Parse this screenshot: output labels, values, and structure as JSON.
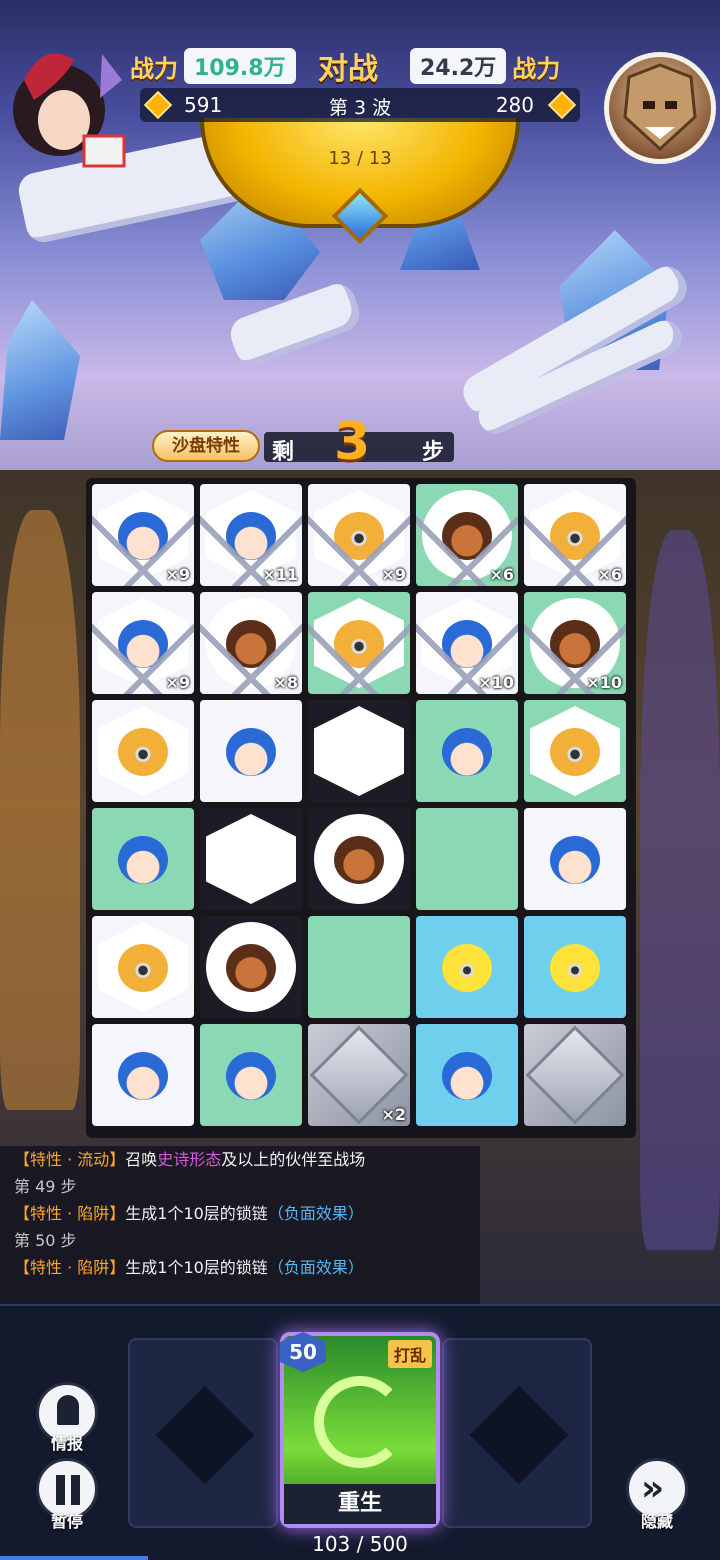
{
  "header": {
    "player_power_label": "战力",
    "player_power": "109.8万",
    "vs_label": "对战",
    "enemy_power": "24.2万",
    "enemy_power_label": "战力",
    "player_score": "591",
    "wave": "第 3 波",
    "enemy_score": "280",
    "wave_progress": "13 / 13"
  },
  "steps": {
    "trait_button": "沙盘特性",
    "left_label": "剩",
    "count": "3",
    "unit_label": "步"
  },
  "board": {
    "rows": [
      [
        {
          "type": "blue-hair",
          "bg": "white",
          "shape": "hex",
          "chain": true,
          "mult": "×9"
        },
        {
          "type": "blue-hair",
          "bg": "white",
          "shape": "hex",
          "chain": true,
          "mult": "×11"
        },
        {
          "type": "yellow-hat",
          "bg": "white",
          "shape": "hex",
          "chain": true,
          "mult": "×9"
        },
        {
          "type": "monkey",
          "bg": "green",
          "shape": "circle",
          "chain": true,
          "mult": "×6"
        },
        {
          "type": "yellow-hat",
          "bg": "white",
          "shape": "hex",
          "chain": true,
          "mult": "×6"
        }
      ],
      [
        {
          "type": "blue-hair",
          "bg": "white",
          "shape": "hex",
          "chain": true,
          "mult": "×9"
        },
        {
          "type": "monkey",
          "bg": "white",
          "shape": "circle",
          "chain": true,
          "mult": "×8"
        },
        {
          "type": "yellow-hat",
          "bg": "green",
          "shape": "hex",
          "chain": true,
          "mult": ""
        },
        {
          "type": "blue-hair",
          "bg": "white",
          "shape": "hex",
          "chain": true,
          "mult": "×10"
        },
        {
          "type": "monkey",
          "bg": "green",
          "shape": "circle",
          "chain": true,
          "mult": "×10"
        }
      ],
      [
        {
          "type": "yellow-hat",
          "bg": "white",
          "shape": "hex",
          "chain": false,
          "mult": ""
        },
        {
          "type": "blue-hair",
          "bg": "white",
          "shape": "none",
          "chain": false,
          "mult": ""
        },
        {
          "type": "empty",
          "bg": "dark",
          "shape": "hex",
          "chain": false,
          "mult": ""
        },
        {
          "type": "blue-hair",
          "bg": "green",
          "shape": "none",
          "chain": false,
          "mult": ""
        },
        {
          "type": "yellow-hat",
          "bg": "green",
          "shape": "hex",
          "chain": false,
          "mult": ""
        }
      ],
      [
        {
          "type": "blue-hair",
          "bg": "green",
          "shape": "none",
          "chain": false,
          "mult": ""
        },
        {
          "type": "empty",
          "bg": "dark",
          "shape": "hex",
          "chain": false,
          "mult": ""
        },
        {
          "type": "monkey",
          "bg": "dark",
          "shape": "circle",
          "chain": false,
          "mult": ""
        },
        {
          "type": "empty",
          "bg": "green",
          "shape": "none",
          "chain": false,
          "mult": ""
        },
        {
          "type": "blue-hair",
          "bg": "white",
          "shape": "none",
          "chain": false,
          "mult": ""
        }
      ],
      [
        {
          "type": "yellow-hat",
          "bg": "white",
          "shape": "hex",
          "chain": false,
          "mult": ""
        },
        {
          "type": "monkey",
          "bg": "dark",
          "shape": "circle",
          "chain": false,
          "mult": ""
        },
        {
          "type": "empty",
          "bg": "green",
          "shape": "none",
          "chain": false,
          "mult": ""
        },
        {
          "type": "yellow-big",
          "bg": "blue",
          "shape": "none",
          "chain": false,
          "mult": ""
        },
        {
          "type": "yellow-big",
          "bg": "blue",
          "shape": "none",
          "chain": false,
          "mult": ""
        }
      ],
      [
        {
          "type": "blue-hair",
          "bg": "white",
          "shape": "none",
          "chain": false,
          "mult": ""
        },
        {
          "type": "blue-hair",
          "bg": "green",
          "shape": "none",
          "chain": false,
          "mult": ""
        },
        {
          "type": "stone",
          "bg": "metal",
          "shape": "none",
          "chain": false,
          "mult": "×2"
        },
        {
          "type": "blue-hair",
          "bg": "blue",
          "shape": "none",
          "chain": false,
          "mult": ""
        },
        {
          "type": "stone",
          "bg": "metal",
          "shape": "none",
          "chain": false,
          "mult": ""
        }
      ]
    ]
  },
  "log": [
    {
      "kind": "effect",
      "tag": "【特性 · 流动】",
      "text": "召唤",
      "highlight": "史诗形态",
      "highlight_class": "epic",
      "tail": "及以上的伙伴至战场"
    },
    {
      "kind": "step",
      "text": "第 49 步"
    },
    {
      "kind": "effect",
      "tag": "【特性 · 陷阱】",
      "text": "生成1个10层的锁链",
      "highlight": "（负面效果）",
      "highlight_class": "neg",
      "tail": ""
    },
    {
      "kind": "step",
      "text": "第 50 步"
    },
    {
      "kind": "effect",
      "tag": "【特性 · 陷阱】",
      "text": "生成1个10层的锁链",
      "highlight": "（负面效果）",
      "highlight_class": "neg",
      "tail": ""
    }
  ],
  "controls": {
    "info_label": "情报",
    "pause_label": "暂停",
    "hide_label": "隐藏",
    "hide_glyph": "»"
  },
  "skill": {
    "cost": "50",
    "tag": "打乱",
    "name": "重生"
  },
  "energy": {
    "current": 103,
    "max": 500,
    "text": "103 / 500"
  },
  "colors": {
    "player_power": "#2fb38a",
    "enemy_power": "#333a4a"
  }
}
